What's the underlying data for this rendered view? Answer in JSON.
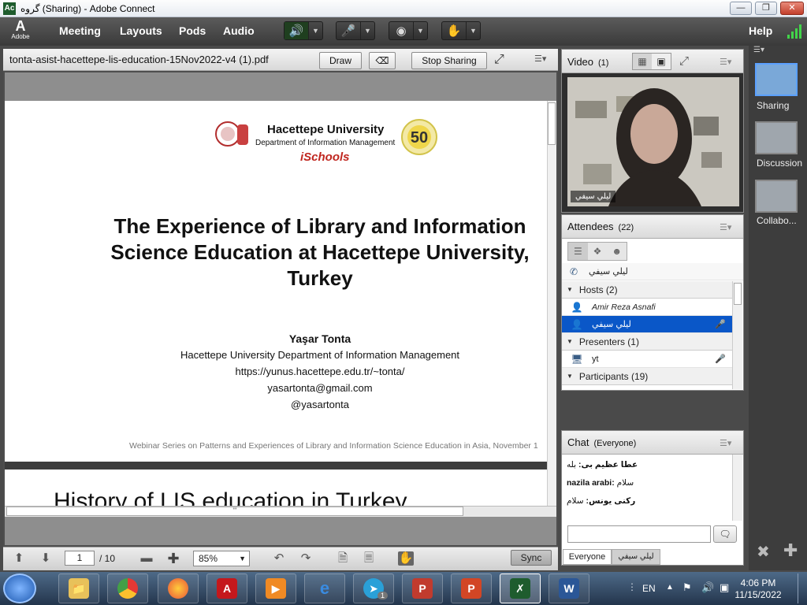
{
  "window": {
    "title": "گروه (Sharing) - Adobe Connect",
    "app_icon": "Ac",
    "controls": [
      "minimize-icon",
      "maximize-icon",
      "close-icon"
    ]
  },
  "menubar": {
    "logo_glyph": "A",
    "logo_word": "Adobe",
    "items": [
      "Meeting",
      "Layouts",
      "Pods",
      "Audio"
    ],
    "help": "Help",
    "toolbar_icons": [
      "speaker-icon",
      "microphone-icon",
      "webcam-icon",
      "raise-hand-icon"
    ]
  },
  "share_pod": {
    "document": "tonta-asist-hacettepe-lis-education-15Nov2022-v4 (1).pdf",
    "draw": "Draw",
    "stop_sharing": "Stop Sharing",
    "scroll_grip": "'''"
  },
  "slide1": {
    "university": "Hacettepe University",
    "department": "Department of Information Management",
    "ischools": "iSchools",
    "logo_left": "50",
    "logo_right": "50",
    "title_lines": [
      "The Experience of Library and Information",
      "Science Education at Hacettepe University,",
      "Turkey"
    ],
    "author": "Yaşar Tonta",
    "affiliation": "Hacettepe University Department of Information Management",
    "url": "https://yunus.hacettepe.edu.tr/~tonta/",
    "email": "yasartonta@gmail.com",
    "handle": "@yasartonta",
    "footer": "Webinar Series on Patterns and Experiences of Library and Information Science Education in Asia, November 1"
  },
  "slide2": {
    "title": "History of LIS education in Turkey"
  },
  "footer": {
    "page": "1",
    "page_total": "/ 10",
    "zoom": "85%",
    "sync": "Sync"
  },
  "video_pod": {
    "title": "Video",
    "count": "(1)",
    "presenter_name": "لیلي سيفي"
  },
  "attendees_pod": {
    "title": "Attendees",
    "count": "(22)",
    "current_user": "لیلي سيفي",
    "hosts_label": "Hosts (2)",
    "hosts": [
      "Amir Reza Asnafi",
      "لیلي سيفي"
    ],
    "presenters_label": "Presenters (1)",
    "presenters": [
      "yt"
    ],
    "participants_label": "Participants (19)"
  },
  "chat_pod": {
    "title": "Chat",
    "scope": "(Everyone)",
    "messages": [
      {
        "sender": "عطا عظیم بی:",
        "text": "بله"
      },
      {
        "sender": "nazila arabi:",
        "text": "سلام"
      },
      {
        "sender": "رکنی یونس:",
        "text": "سلام"
      }
    ],
    "tabs": [
      "Everyone",
      "لیلي سيفي"
    ],
    "send_icon": "speech-bubble-icon"
  },
  "layouts": {
    "items": [
      "Sharing",
      "Discussion",
      "Collabo..."
    ]
  },
  "taskbar": {
    "apps": [
      "file-explorer-icon",
      "chrome-icon",
      "firefox-icon",
      "acrobat-icon",
      "media-player-icon",
      "internet-explorer-icon",
      "telegram-icon",
      "publisher-icon",
      "powerpoint-icon",
      "adobe-connect-icon",
      "word-icon"
    ],
    "telegram_badge": "1",
    "language": "EN",
    "time": "4:06 PM",
    "date": "11/15/2022"
  },
  "colors": {
    "menubar": "#3f3f3f",
    "selected_row": "#0a57c8",
    "speaker_active": "#35e04a",
    "taskbar": "#2d4560"
  }
}
